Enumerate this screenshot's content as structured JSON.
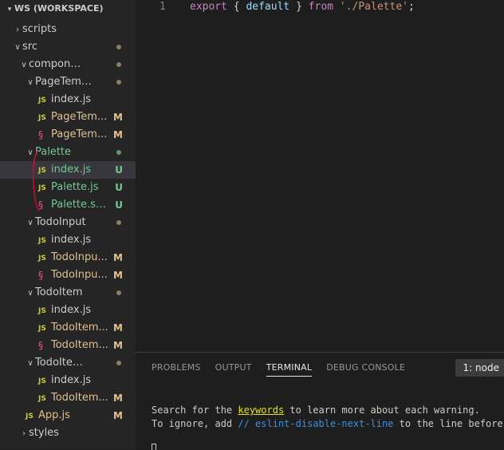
{
  "workspace": {
    "title": "WS (WORKSPACE)"
  },
  "colors": {
    "js": "#cbcb41",
    "scss": "#f55385",
    "modified": "#e2c08d",
    "untracked": "#73c991",
    "dot_modified": "#8c7e5f",
    "dot_untracked": "#5b9a6e"
  },
  "tree": [
    {
      "label": "scripts",
      "kind": "folder",
      "open": false,
      "status": ""
    },
    {
      "label": "src",
      "kind": "folder",
      "open": true,
      "status": "dot"
    },
    {
      "label": "components",
      "kind": "folder",
      "open": true,
      "status": "dot"
    },
    {
      "label": "PageTemp...",
      "kind": "folder",
      "open": true,
      "status": "dot"
    },
    {
      "label": "index.js",
      "kind": "js",
      "status": ""
    },
    {
      "label": "PageTem...",
      "kind": "js",
      "status": "M"
    },
    {
      "label": "PageTem...",
      "kind": "scss",
      "status": "M"
    },
    {
      "label": "Palette",
      "kind": "folder",
      "open": true,
      "status": "dot-untracked"
    },
    {
      "label": "index.js",
      "kind": "js",
      "status": "U",
      "selected": true
    },
    {
      "label": "Palette.js",
      "kind": "js",
      "status": "U"
    },
    {
      "label": "Palette.scss",
      "kind": "scss",
      "status": "U"
    },
    {
      "label": "TodoInput",
      "kind": "folder",
      "open": true,
      "status": "dot"
    },
    {
      "label": "index.js",
      "kind": "js",
      "status": ""
    },
    {
      "label": "TodoInpu...",
      "kind": "js",
      "status": "M"
    },
    {
      "label": "TodoInpu...",
      "kind": "scss",
      "status": "M"
    },
    {
      "label": "TodoItem",
      "kind": "folder",
      "open": true,
      "status": "dot"
    },
    {
      "label": "index.js",
      "kind": "js",
      "status": ""
    },
    {
      "label": "TodoItem...",
      "kind": "js",
      "status": "M"
    },
    {
      "label": "TodoItem...",
      "kind": "scss",
      "status": "M"
    },
    {
      "label": "TodoItemL...",
      "kind": "folder",
      "open": true,
      "status": "dot"
    },
    {
      "label": "index.js",
      "kind": "js",
      "status": ""
    },
    {
      "label": "TodoItem...",
      "kind": "js",
      "status": "M"
    },
    {
      "label": "App.js",
      "kind": "js",
      "status": "M"
    },
    {
      "label": "styles",
      "kind": "folder",
      "open": false,
      "status": ""
    }
  ],
  "editor": {
    "line_number": "1",
    "code": {
      "kw1": "export",
      "open": " { ",
      "id": "default",
      "close": " } ",
      "kw2": "from",
      "sp": " ",
      "str": "'./Palette'",
      "end": ";"
    }
  },
  "panel": {
    "tabs": [
      "PROBLEMS",
      "OUTPUT",
      "TERMINAL",
      "DEBUG CONSOLE"
    ],
    "active_tab": 2,
    "terminal_select": "1: node",
    "terminal": {
      "l1_a": "Search for the ",
      "l1_kw": "keywords",
      "l1_b": " to learn more about each warning.",
      "l2_a": "To ignore, add ",
      "l2_cm": "// eslint-disable-next-line",
      "l2_b": " to the line before."
    }
  }
}
